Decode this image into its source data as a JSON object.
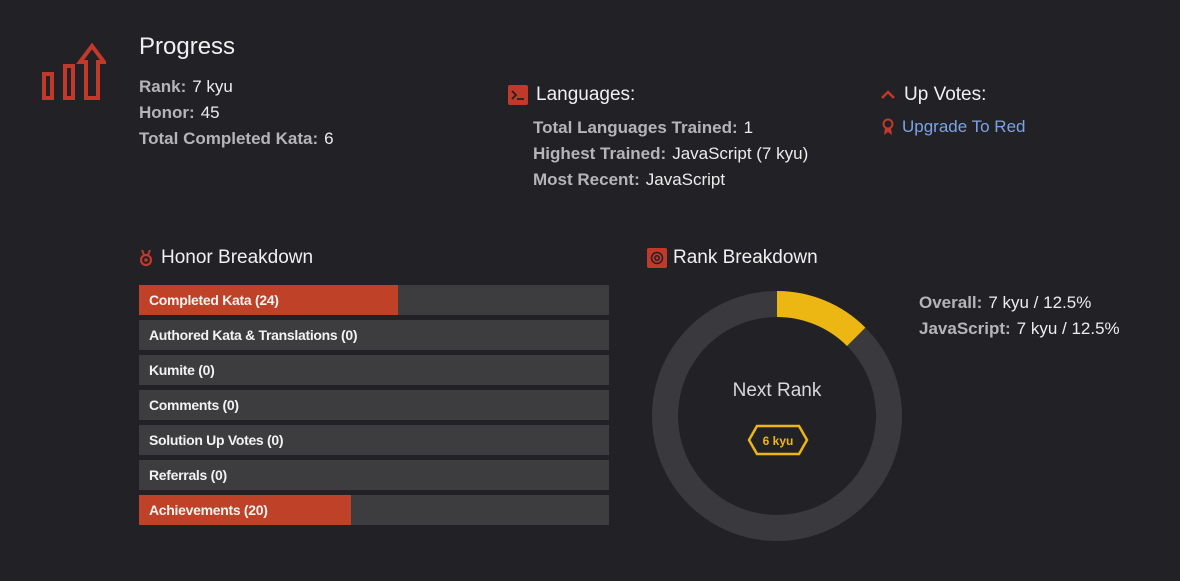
{
  "progress": {
    "title": "Progress",
    "rank_label": "Rank:",
    "rank_value": "7 kyu",
    "honor_label": "Honor:",
    "honor_value": "45",
    "completed_label": "Total Completed Kata:",
    "completed_value": "6",
    "icon": "progress-chart-icon"
  },
  "languages": {
    "title": "Languages:",
    "icon": "terminal-icon",
    "total_label": "Total Languages Trained:",
    "total_value": "1",
    "highest_label": "Highest Trained:",
    "highest_value": "JavaScript (7 kyu)",
    "recent_label": "Most Recent:",
    "recent_value": "JavaScript"
  },
  "upvotes": {
    "title": "Up Votes:",
    "icon": "chevron-up-icon",
    "link_label": "Upgrade To Red",
    "link_icon": "ribbon-icon"
  },
  "honor_breakdown": {
    "title": "Honor Breakdown",
    "icon": "medal-icon",
    "bars": [
      {
        "label": "Completed Kata (24)",
        "fraction": 0.55
      },
      {
        "label": "Authored Kata & Translations (0)",
        "fraction": 0
      },
      {
        "label": "Kumite (0)",
        "fraction": 0
      },
      {
        "label": "Comments (0)",
        "fraction": 0
      },
      {
        "label": "Solution Up Votes (0)",
        "fraction": 0
      },
      {
        "label": "Referrals (0)",
        "fraction": 0
      },
      {
        "label": "Achievements (20)",
        "fraction": 0.45
      }
    ]
  },
  "rank_breakdown": {
    "title": "Rank Breakdown",
    "icon": "target-icon",
    "progress_fraction": 0.125,
    "next_rank_label": "Next Rank",
    "next_rank_badge": "6 kyu",
    "overall_label": "Overall:",
    "overall_value": "7 kyu / 12.5%",
    "js_label": "JavaScript:",
    "js_value": "7 kyu / 12.5%"
  },
  "colors": {
    "background": "#222226",
    "accent_red": "#bf4128",
    "bar_track": "#3d3d40",
    "rank_yellow": "#ecb613",
    "donut_track": "#3a3a3e",
    "link_blue": "#7aa3e6"
  }
}
